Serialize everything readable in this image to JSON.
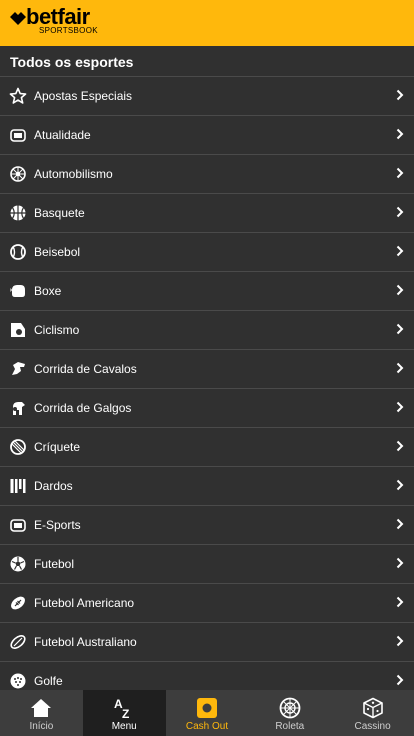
{
  "brand": {
    "name": "betfair",
    "sub": "SPORTSBOOK"
  },
  "section_title": "Todos os esportes",
  "colors": {
    "accent": "#ffb80c",
    "background": "#303030",
    "nav": "#3d3d3d"
  },
  "sports": [
    {
      "label": "Apostas Especiais",
      "icon": "star-icon"
    },
    {
      "label": "Atualidade",
      "icon": "podium-icon"
    },
    {
      "label": "Automobilismo",
      "icon": "wheel-icon"
    },
    {
      "label": "Basquete",
      "icon": "basketball-icon"
    },
    {
      "label": "Beisebol",
      "icon": "baseball-icon"
    },
    {
      "label": "Boxe",
      "icon": "boxing-glove-icon"
    },
    {
      "label": "Ciclismo",
      "icon": "cycling-icon"
    },
    {
      "label": "Corrida de Cavalos",
      "icon": "horse-icon"
    },
    {
      "label": "Corrida de Galgos",
      "icon": "greyhound-icon"
    },
    {
      "label": "Críquete",
      "icon": "cricket-icon"
    },
    {
      "label": "Dardos",
      "icon": "darts-icon"
    },
    {
      "label": "E-Sports",
      "icon": "gamepad-icon"
    },
    {
      "label": "Futebol",
      "icon": "soccer-ball-icon"
    },
    {
      "label": "Futebol Americano",
      "icon": "american-football-icon"
    },
    {
      "label": "Futebol Australiano",
      "icon": "aussie-rules-icon"
    },
    {
      "label": "Golfe",
      "icon": "golf-ball-icon"
    }
  ],
  "nav": [
    {
      "label": "Início",
      "icon": "home-icon"
    },
    {
      "label": "Menu",
      "icon": "az-menu-icon",
      "active": true
    },
    {
      "label": "Cash Out",
      "icon": "cash-out-icon"
    },
    {
      "label": "Roleta",
      "icon": "roulette-icon"
    },
    {
      "label": "Cassino",
      "icon": "dice-icon"
    }
  ]
}
